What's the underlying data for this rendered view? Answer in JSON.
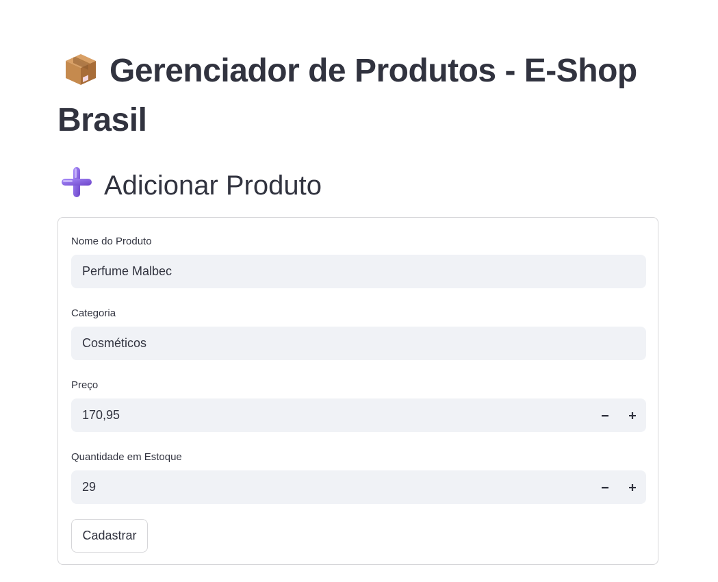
{
  "page": {
    "title": "Gerenciador de Produtos - E-Shop Brasil",
    "title_icon": "package-icon"
  },
  "section": {
    "heading": "Adicionar Produto",
    "heading_icon": "plus-icon"
  },
  "form": {
    "fields": [
      {
        "label": "Nome do Produto",
        "value": "Perfume Malbec",
        "type": "text"
      },
      {
        "label": "Categoria",
        "value": "Cosméticos",
        "type": "text"
      },
      {
        "label": "Preço",
        "value": "170,95",
        "type": "number"
      },
      {
        "label": "Quantidade em Estoque",
        "value": "29",
        "type": "number"
      }
    ],
    "submit_label": "Cadastrar"
  },
  "colors": {
    "text": "#31333f",
    "input_bg": "#f0f2f6",
    "border": "#d6d6d9",
    "icon_purple": "#7b5bd6",
    "box_brown": "#c58a4e"
  }
}
